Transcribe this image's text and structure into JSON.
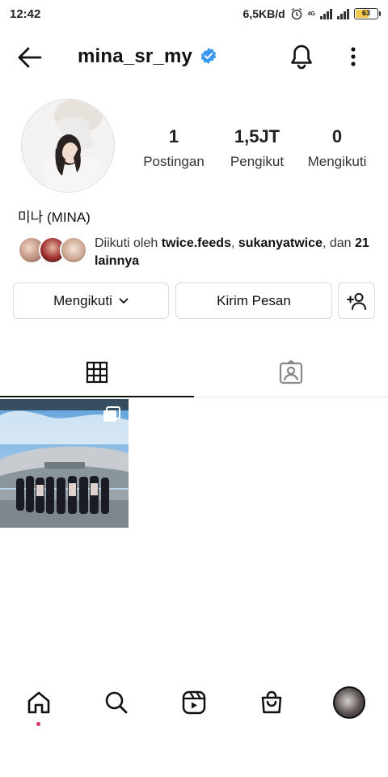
{
  "status_bar": {
    "time": "12:42",
    "net_speed": "6,5KB/d",
    "network_type": "4G",
    "battery_level": "63",
    "battery_color": "#f2c94c"
  },
  "header": {
    "username": "mina_sr_my",
    "verified": true,
    "verified_color": "#3897f0",
    "icons": [
      "back-arrow-icon",
      "verified-badge-icon",
      "bell-icon",
      "more-vertical-icon"
    ]
  },
  "profile": {
    "display_name": "미나 (MINA)",
    "stats": [
      {
        "value": "1",
        "label": "Postingan"
      },
      {
        "value": "1,5JT",
        "label": "Pengikut"
      },
      {
        "value": "0",
        "label": "Mengikuti"
      }
    ],
    "followed_by": {
      "prefix": "Diikuti oleh ",
      "user1": "twice.feeds",
      "separator": ", ",
      "user2": "sukanyatwice",
      "middle": ", dan ",
      "others": "21 lainnya"
    }
  },
  "actions": {
    "follow_label": "Mengikuti",
    "message_label": "Kirim Pesan",
    "suggest_icon": "add-person-icon"
  },
  "tabs": [
    {
      "name": "grid",
      "icon": "grid-icon",
      "active": true
    },
    {
      "name": "tagged",
      "icon": "tagged-person-icon",
      "active": false
    }
  ],
  "posts": [
    {
      "type": "multi-photo",
      "icon": "carousel-icon"
    }
  ],
  "bottom_nav": {
    "items": [
      "home-icon",
      "search-icon",
      "reels-icon",
      "shop-icon",
      "profile-avatar"
    ],
    "active": "home-icon",
    "notification_dot_color": "#e1306c"
  }
}
